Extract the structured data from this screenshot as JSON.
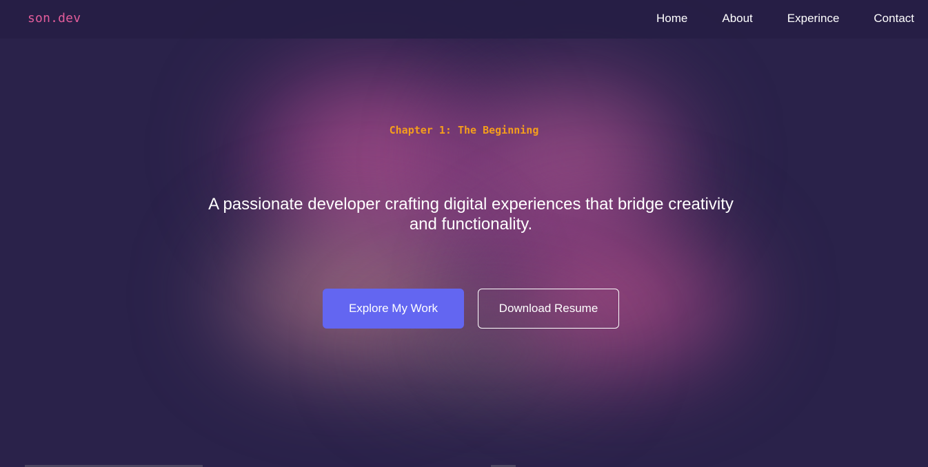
{
  "navbar": {
    "logo": "son.dev",
    "links": [
      {
        "label": "Home"
      },
      {
        "label": "About"
      },
      {
        "label": "Experince"
      },
      {
        "label": "Contact"
      }
    ]
  },
  "hero": {
    "chapter": "Chapter 1: The Beginning",
    "tagline": "A passionate developer crafting digital experiences that bridge creativity and functionality.",
    "primary_button": "Explore My Work",
    "secondary_button": "Download Resume"
  },
  "colors": {
    "background": "#2a224a",
    "logo": "#e35d9b",
    "chapter": "#f59e1c",
    "primary_button": "#6366f1",
    "text": "#ffffff"
  }
}
